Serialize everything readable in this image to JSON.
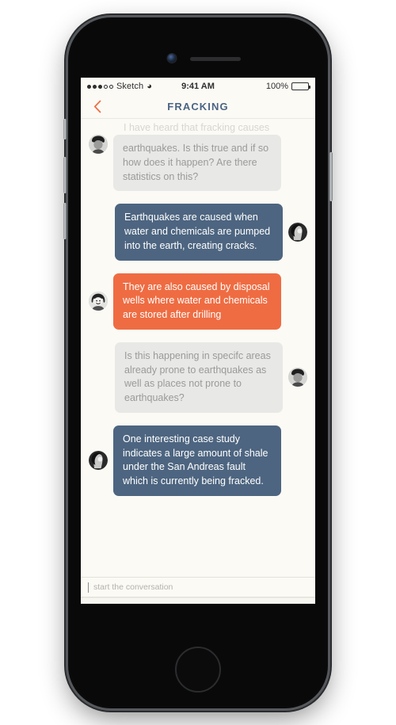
{
  "device": {
    "type": "smartphone-mockup",
    "hardware": {
      "speaker_grille": "speaker-grille",
      "front_camera": "front-camera-icon",
      "home_button": "home-button",
      "silent_switch": "silent-switch",
      "volume_up": "volume-up-button",
      "volume_down": "volume-down-button",
      "power": "power-button"
    }
  },
  "status_bar": {
    "carrier": "Sketch",
    "signal_dots_filled": 3,
    "signal_dots_total": 5,
    "wifi_icon": "wifi-icon",
    "time": "9:41 AM",
    "battery_percent": "100%",
    "battery_level": 100
  },
  "nav_bar": {
    "back_icon": "chevron-left-icon",
    "title": "FRACKING",
    "accent_color": "#ef6c42",
    "title_color": "#4a6484"
  },
  "conversation": {
    "scrolled_off_peek": "I have heard that fracking causes",
    "messages": [
      {
        "id": "msg-1",
        "side": "incoming",
        "style": "gray",
        "clipped_top": true,
        "avatar": "avatar-man-dark",
        "text": "earthquakes. Is this true and if so how does it happen? Are there statistics on this?"
      },
      {
        "id": "msg-2",
        "side": "outgoing",
        "style": "blue",
        "clipped_top": false,
        "avatar": "avatar-woman-side",
        "text": "Earthquakes are caused when water and chemicals are pumped into the earth, creating cracks."
      },
      {
        "id": "msg-3",
        "side": "incoming",
        "style": "orange",
        "clipped_top": false,
        "avatar": "avatar-woman-smiling",
        "text": "They are also caused by disposal wells where water and chemicals are stored after drilling"
      },
      {
        "id": "msg-4",
        "side": "outgoing",
        "style": "gray",
        "clipped_top": false,
        "avatar": "avatar-man-dark",
        "text": "Is this happening in specifc areas already prone to earthquakes as well as places not prone to earthquakes?"
      },
      {
        "id": "msg-5",
        "side": "incoming",
        "style": "blue",
        "clipped_top": false,
        "avatar": "avatar-woman-side",
        "text": "One interesting case study indicates a large amount of shale under the San Andreas fault which is currently being fracked."
      }
    ],
    "bubble_colors": {
      "gray": "#e8e8e6",
      "blue": "#4d6580",
      "orange": "#ef6c42"
    }
  },
  "composer": {
    "placeholder": "start the conversation",
    "value": ""
  },
  "tab_bar": {
    "items": [
      {
        "name": "tab-network",
        "icon": "share-nodes-icon",
        "label": ""
      },
      {
        "name": "tab-recent",
        "icon": "clock-icon",
        "label": ""
      },
      {
        "name": "tab-profile",
        "icon": "person-icon",
        "label": ""
      },
      {
        "name": "tab-messages",
        "icon": "chat-bubble-icon",
        "label": ""
      },
      {
        "name": "tab-favorites",
        "icon": "star-icon",
        "label": ""
      }
    ]
  }
}
